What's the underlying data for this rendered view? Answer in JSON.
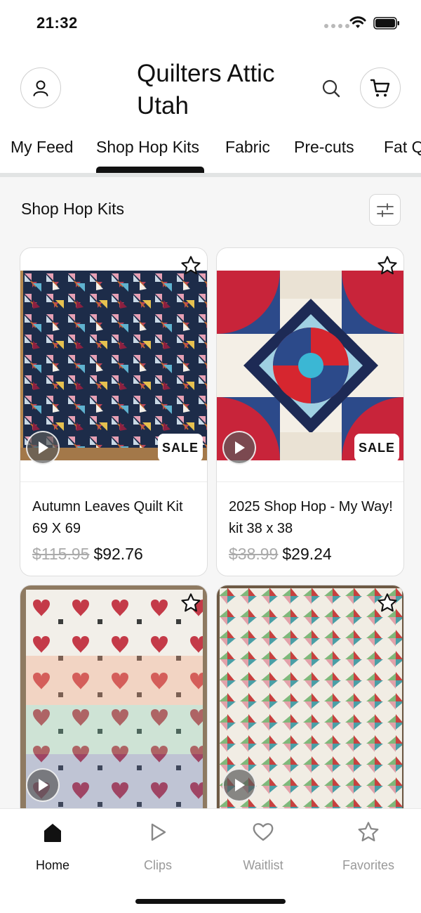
{
  "status": {
    "time": "21:32"
  },
  "header": {
    "title": "Quilters Attic Utah",
    "icons": {
      "profile": "person-icon",
      "search": "search-icon",
      "cart": "cart-icon"
    }
  },
  "tabs": [
    {
      "label": "My Feed",
      "active": false
    },
    {
      "label": "Shop Hop Kits",
      "active": true
    },
    {
      "label": "Fabric",
      "active": false
    },
    {
      "label": "Pre-cuts",
      "active": false
    },
    {
      "label": "Fat Q",
      "active": false
    }
  ],
  "section": {
    "title": "Shop Hop Kits",
    "filter_icon": "sliders-icon"
  },
  "products": [
    {
      "name": "Autumn Leaves Quilt Kit  69 X 69",
      "old_price": "$115.95",
      "price": "$92.76",
      "badge": "SALE"
    },
    {
      "name": "2025 Shop Hop - My Way! kit  38 x 38",
      "old_price": "$38.99",
      "price": "$29.24",
      "badge": "SALE"
    },
    {
      "name": "",
      "old_price": "",
      "price": "",
      "badge": ""
    },
    {
      "name": "",
      "old_price": "",
      "price": "",
      "badge": ""
    }
  ],
  "bottom_nav": [
    {
      "label": "Home",
      "icon": "home-icon",
      "active": true
    },
    {
      "label": "Clips",
      "icon": "play-icon",
      "active": false
    },
    {
      "label": "Waitlist",
      "icon": "heart-icon",
      "active": false
    },
    {
      "label": "Favorites",
      "icon": "star-icon",
      "active": false
    }
  ],
  "colors": {
    "accent": "#111111",
    "muted": "#999999",
    "background": "#f6f6f6"
  }
}
